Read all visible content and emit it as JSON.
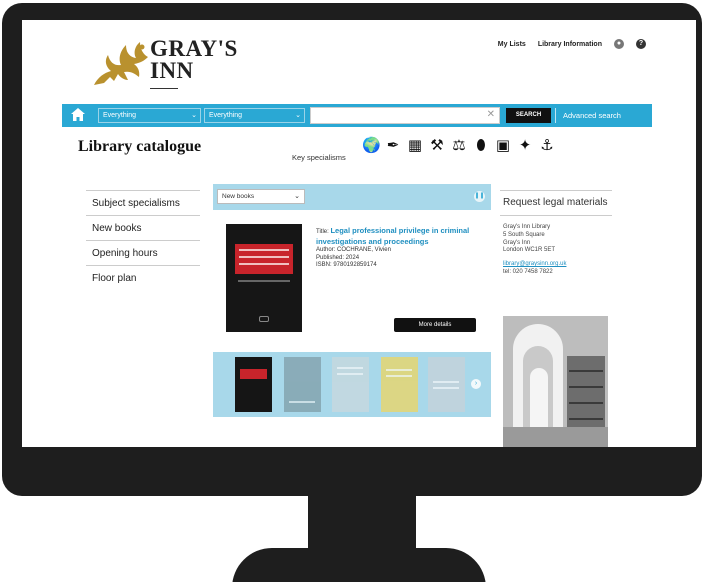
{
  "header": {
    "logo_title_line1": "GRAY'S",
    "logo_title_line2": "INN",
    "links": [
      "My Lists",
      "Library Information"
    ]
  },
  "search": {
    "scope_select": "Everything",
    "type_select": "Everything",
    "query_value": "",
    "search_button": "SEARCH",
    "advanced_link": "Advanced search"
  },
  "catalogue": {
    "title": "Library catalogue",
    "key_specialisms_label": "Key specialisms",
    "specialism_icons": [
      "globe-icon",
      "quill-icon",
      "map-icon",
      "tools-icon",
      "scales-icon",
      "rugby-ball-icon",
      "film-camera-icon",
      "satellite-icon",
      "ship-icon"
    ]
  },
  "nav": {
    "items": [
      "Subject specialisms",
      "New books",
      "Opening hours",
      "Floor plan"
    ]
  },
  "featured": {
    "select_label": "New books",
    "title_prefix": "Title:",
    "title": "Legal professional privilege in criminal investigations and proceedings",
    "author": "Author: COCHRANE, Vivien",
    "published": "Published: 2024",
    "isbn": "ISBN: 9780192859174",
    "more_details": "More details"
  },
  "sidebar": {
    "request_title": "Request legal materials",
    "address": [
      "Gray's Inn Library",
      "5 South Square",
      "Gray's Inn",
      "London WC1R 5ET"
    ],
    "email": "library@graysinn.org.uk",
    "tel": "tel: 020 7458 7822"
  },
  "colors": {
    "brand_blue": "#2aa8d4",
    "panel_blue": "#a8d8ea",
    "link_blue": "#1f8fc0",
    "frame": "#1e1e1e"
  }
}
